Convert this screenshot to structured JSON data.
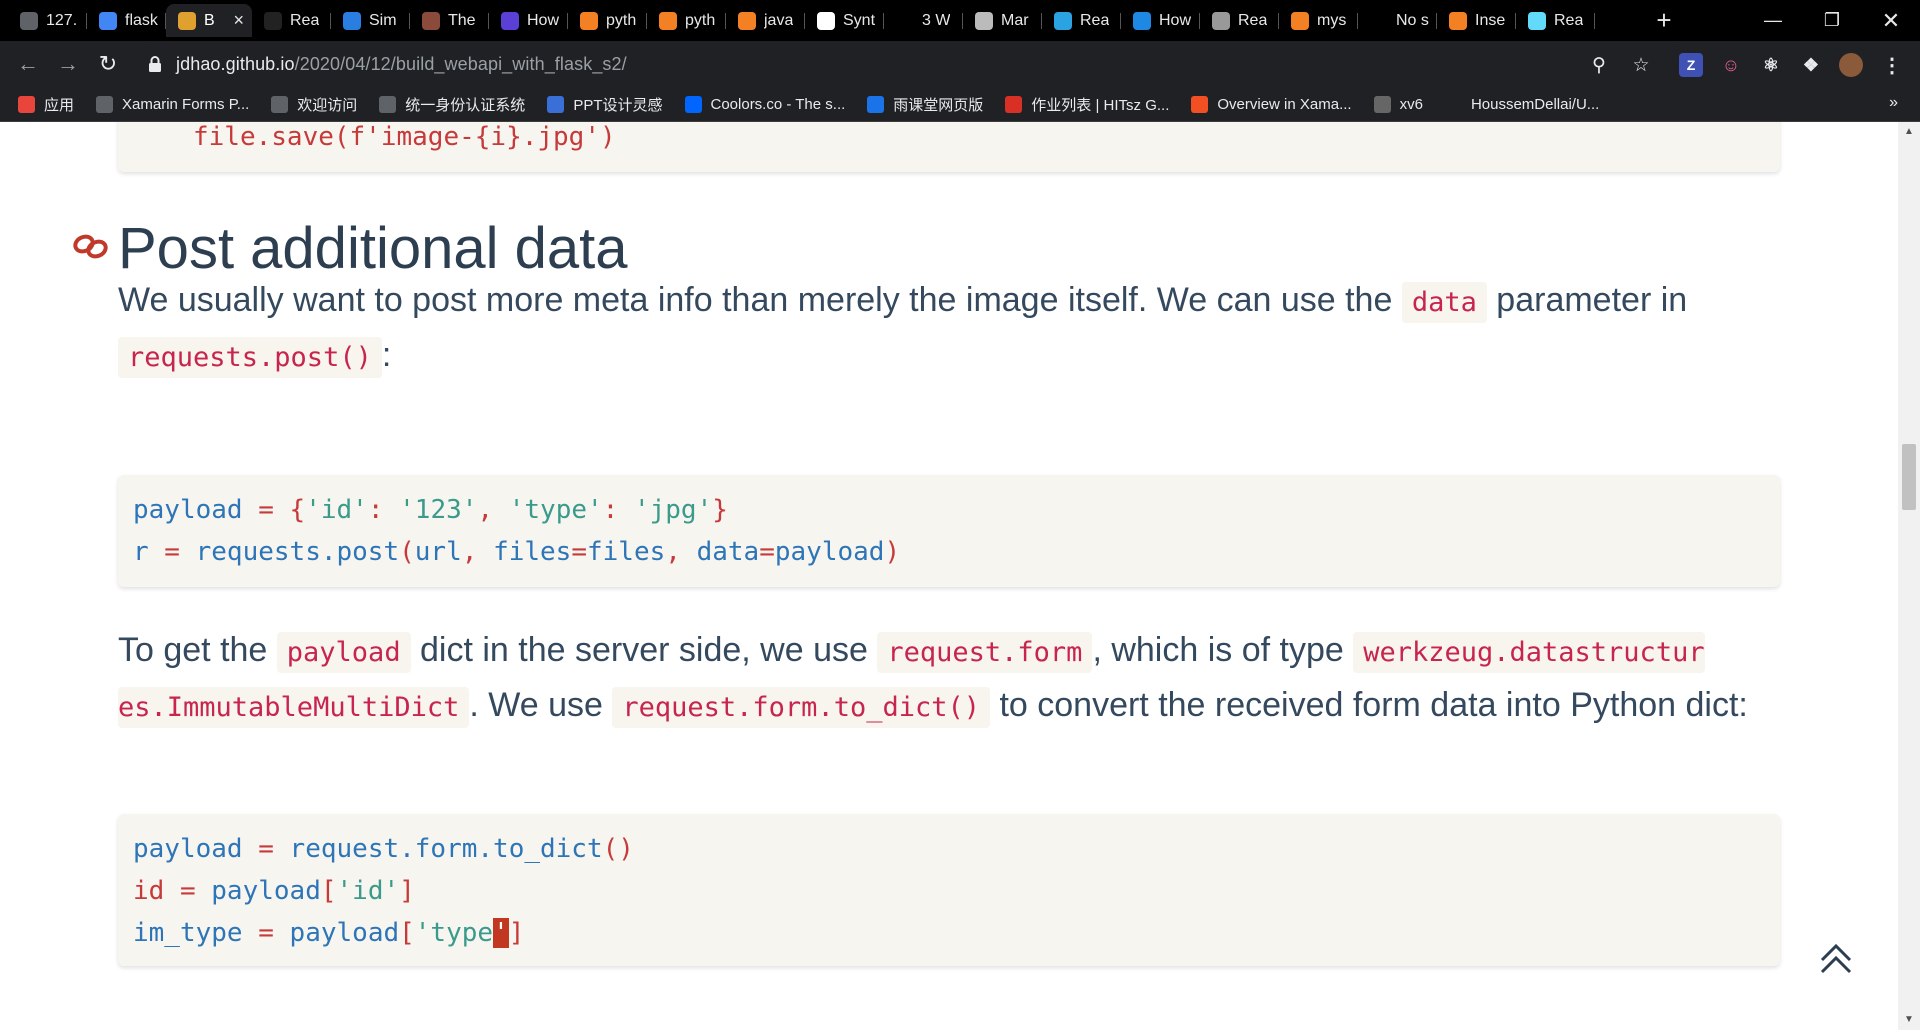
{
  "tabs": [
    {
      "title": "127.",
      "icon": "chrome-icon",
      "color": "#5f6368"
    },
    {
      "title": "flask",
      "icon": "google-icon",
      "color": "#4285f4"
    },
    {
      "title": "B",
      "icon": "tiger-icon",
      "color": "#e0a030",
      "active": true
    },
    {
      "title": "Rea",
      "icon": "medium-icon",
      "color": "#222222"
    },
    {
      "title": "Sim",
      "icon": "spinner-icon",
      "color": "#2a7de1"
    },
    {
      "title": "The",
      "icon": "photo-icon",
      "color": "#8a4b3a"
    },
    {
      "title": "How",
      "icon": "a-icon",
      "color": "#5b3fd6"
    },
    {
      "title": "pyth",
      "icon": "stackoverflow-icon",
      "color": "#f48024"
    },
    {
      "title": "pyth",
      "icon": "stackoverflow-icon",
      "color": "#f48024"
    },
    {
      "title": "java",
      "icon": "stackoverflow-icon",
      "color": "#f48024"
    },
    {
      "title": "Synt",
      "icon": "bird-icon",
      "color": "#ffffff"
    },
    {
      "title": "3 W",
      "icon": "blank-icon",
      "color": "#000000"
    },
    {
      "title": "Mar",
      "icon": "cube-icon",
      "color": "#bbbbbb"
    },
    {
      "title": "Rea",
      "icon": "brain-icon",
      "color": "#2ba3e3"
    },
    {
      "title": "How",
      "icon": "refresh-icon",
      "color": "#1e88e5"
    },
    {
      "title": "Rea",
      "icon": "doc-icon",
      "color": "#999999"
    },
    {
      "title": "mys",
      "icon": "stackoverflow-icon",
      "color": "#f48024"
    },
    {
      "title": "No s",
      "icon": "blank-icon",
      "color": "#000000"
    },
    {
      "title": "Inse",
      "icon": "stackoverflow-icon",
      "color": "#f48024"
    },
    {
      "title": "Rea",
      "icon": "react-icon",
      "color": "#61dafb"
    }
  ],
  "toolbar": {
    "url_host": "jdhao.github.io",
    "url_path": "/2020/04/12/build_webapi_with_flask_s2/"
  },
  "bookmarks": [
    {
      "label": "应用",
      "icon": "apps-icon",
      "color": "#e8453c"
    },
    {
      "label": "Xamarin Forms P...",
      "icon": "chrome-icon",
      "color": "#5f6368"
    },
    {
      "label": "欢迎访问",
      "icon": "chrome-icon",
      "color": "#5f6368"
    },
    {
      "label": "统一身份认证系统",
      "icon": "chrome-icon",
      "color": "#5f6368"
    },
    {
      "label": "PPT设计灵感",
      "icon": "feather-icon",
      "color": "#3a6fd8"
    },
    {
      "label": "Coolors.co - The s...",
      "icon": "coolors-icon",
      "color": "#0066ff"
    },
    {
      "label": "雨课堂网页版",
      "icon": "rain-icon",
      "color": "#1a73e8"
    },
    {
      "label": "作业列表 | HITsz G...",
      "icon": "score-icon",
      "color": "#d93025"
    },
    {
      "label": "Overview in Xama...",
      "icon": "microsoft-icon",
      "color": "#f25022"
    },
    {
      "label": "xv6",
      "icon": "pdos-icon",
      "color": "#666666"
    },
    {
      "label": "HoussemDellai/U...",
      "icon": "github-icon",
      "color": "#202124"
    }
  ],
  "article": {
    "prev_code": "file.save(f'image-{i}.jpg')",
    "heading": "Post additional data",
    "para1_before": "We usually want to post more meta info than merely the image itself. We can use the ",
    "para1_code1": "data",
    "para1_middle": " parameter in ",
    "para1_code2": "requests.post()",
    "para1_after": ":",
    "code1": {
      "line1": {
        "v1": "payload",
        "eq": " = ",
        "b1": "{",
        "k1": "'id'",
        "colon1": ": ",
        "val1": "'123'",
        "comma1": ", ",
        "k2": "'type'",
        "colon2": ": ",
        "val2": "'jpg'",
        "b2": "}"
      },
      "line2": {
        "v1": "r",
        "eq": " = ",
        "fn": "requests.post",
        "p1": "(",
        "a1": "url",
        "c1": ", ",
        "a2": "files",
        "e2": "=",
        "a2v": "files",
        "c2": ", ",
        "a3": "data",
        "e3": "=",
        "a3v": "payload",
        "p2": ")"
      }
    },
    "para2_before": "To get the ",
    "para2_code1": "payload",
    "para2_mid1": " dict in the server side, we use ",
    "para2_code2": "request.form",
    "para2_mid2": ", which is of type ",
    "para2_code3a": "werkzeug.datastructur",
    "para2_code3b": "es.ImmutableMultiDict",
    "para2_mid3": ". We use ",
    "para2_code4": "request.form.to_dict()",
    "para2_after": " to convert the received form data into Python dict:",
    "code2": {
      "line1": {
        "v": "payload",
        "eq": " = ",
        "fn": "request.form.to_dict",
        "p": "()"
      },
      "line2": {
        "v": "id",
        "eq": " = ",
        "obj": "payload",
        "b1": "[",
        "s": "'id'",
        "b2": "]"
      },
      "line3": {
        "v": "im_type",
        "eq": " = ",
        "obj": "payload",
        "b1": "[",
        "s": "'type",
        "cur": "'",
        "b2": "]"
      }
    }
  }
}
